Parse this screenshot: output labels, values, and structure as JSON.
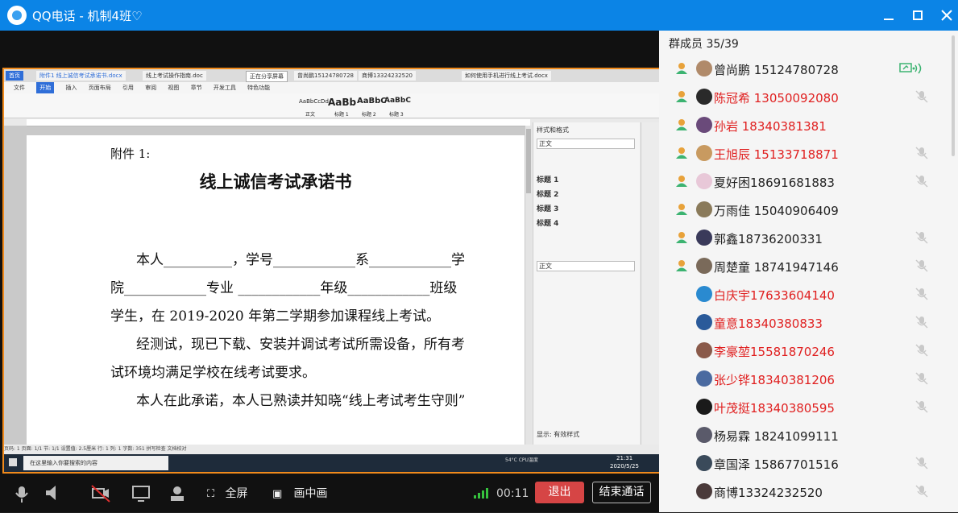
{
  "window": {
    "title": "QQ电话 - 机制4班♡",
    "minimize_icon": "minimize-icon",
    "maximize_icon": "maximize-icon",
    "close_icon": "close-icon"
  },
  "shared_screen": {
    "wps": {
      "tabs": [
        "首页",
        "附件1 线上诚信考试承诺书.docx",
        "线上考试操作指南.doc",
        "正在分享屏幕",
        "曾尚鹏15124780728",
        "商博13324232520",
        "如何使用手机进行线上考试.docx"
      ],
      "menu": [
        "文件",
        "开始",
        "插入",
        "页面布局",
        "引用",
        "审阅",
        "视图",
        "章节",
        "开发工具",
        "特色功能"
      ],
      "styles": [
        "AaBbCcDd",
        "AaBb",
        "AaBbC",
        "AaBbC"
      ],
      "style_names": [
        "正文",
        "标题 1",
        "标题 2",
        "标题 3"
      ],
      "document": {
        "attachment": "附件 1:",
        "title": "线上诚信考试承诺书",
        "line1": "本人__________，学号____________系____________学",
        "line2": "院____________专业 ____________年级____________班级",
        "line3": "学生，在 2019-2020 年第二学期参加课程线上考试。",
        "line4": "经测试，现已下载、安装并调试考试所需设备，所有考",
        "line5": "试环境均满足学校在线考试要求。",
        "line6": "本人在此承诺，本人已熟读并知晓“线上考试考生守则”"
      },
      "style_pane": {
        "header": "样式和格式",
        "current": "正文",
        "items": [
          "标题 1",
          "标题 2",
          "标题 3",
          "标题 4"
        ],
        "show": "显示: 有效样式"
      },
      "status": "页码: 1  页面: 1/1  节: 1/1  设置值: 2.5厘米  行: 1  列: 1  字数: 351  拼写检查  文档校对",
      "taskbar_search": "在这里输入你要搜索的内容",
      "clock_time": "21:31",
      "clock_date": "2020/5/25",
      "cpu": "54°C CPU温度"
    }
  },
  "controls": {
    "fullscreen": "全屏",
    "pip": "画中画",
    "timer": "00:11",
    "exit": "退出",
    "end": "结束通话"
  },
  "panel": {
    "header": "群成员 35/39",
    "members": [
      {
        "name": "曾尚鹏  15124780728",
        "color": "#222222",
        "speaker": true,
        "mic": "sharing",
        "avatar": "#b08a6a"
      },
      {
        "name": "陈冠希 13050092080",
        "color": "#e02020",
        "speaker": true,
        "mic": "muted",
        "avatar": "#2a2a2a"
      },
      {
        "name": "孙岩 18340381381",
        "color": "#e02020",
        "speaker": true,
        "mic": "none",
        "avatar": "#6a4a7a"
      },
      {
        "name": "王旭辰 15133718871",
        "color": "#e02020",
        "speaker": true,
        "mic": "muted",
        "avatar": "#c89a60"
      },
      {
        "name": "夏好困18691681883",
        "color": "#222222",
        "speaker": true,
        "mic": "muted",
        "avatar": "#e8c8d8"
      },
      {
        "name": "万雨佳  15040906409",
        "color": "#222222",
        "speaker": true,
        "mic": "none",
        "avatar": "#8a7a5a"
      },
      {
        "name": "郭鑫18736200331",
        "color": "#222222",
        "speaker": true,
        "mic": "muted",
        "avatar": "#3a3a5a"
      },
      {
        "name": "周楚童  18741947146",
        "color": "#222222",
        "speaker": true,
        "mic": "muted",
        "avatar": "#7a6a5a"
      },
      {
        "name": "白庆宇17633604140",
        "color": "#e02020",
        "speaker": false,
        "mic": "muted",
        "avatar": "#2a8ad0"
      },
      {
        "name": "童意18340380833",
        "color": "#e02020",
        "speaker": false,
        "mic": "muted",
        "avatar": "#2a5a9a"
      },
      {
        "name": "李豪堃15581870246",
        "color": "#e02020",
        "speaker": false,
        "mic": "muted",
        "avatar": "#8a5a4a"
      },
      {
        "name": "张少铧18340381206",
        "color": "#e02020",
        "speaker": false,
        "mic": "muted",
        "avatar": "#4a6aa0"
      },
      {
        "name": "叶茂挺18340380595",
        "color": "#e02020",
        "speaker": false,
        "mic": "muted",
        "avatar": "#1a1a1a"
      },
      {
        "name": "杨易霖  18241099111",
        "color": "#222222",
        "speaker": false,
        "mic": "none",
        "avatar": "#5a5a6a"
      },
      {
        "name": "章国泽 15867701516",
        "color": "#222222",
        "speaker": false,
        "mic": "muted",
        "avatar": "#3a4a5a"
      },
      {
        "name": "商博13324232520",
        "color": "#222222",
        "speaker": false,
        "mic": "muted",
        "avatar": "#4a3a3a"
      }
    ]
  },
  "colors": {
    "titlebar": "#0b84e6",
    "exit": "#d64545",
    "muted_red": "#e02020",
    "share_border": "#f08a1c",
    "speaking_green": "#3cb371"
  }
}
